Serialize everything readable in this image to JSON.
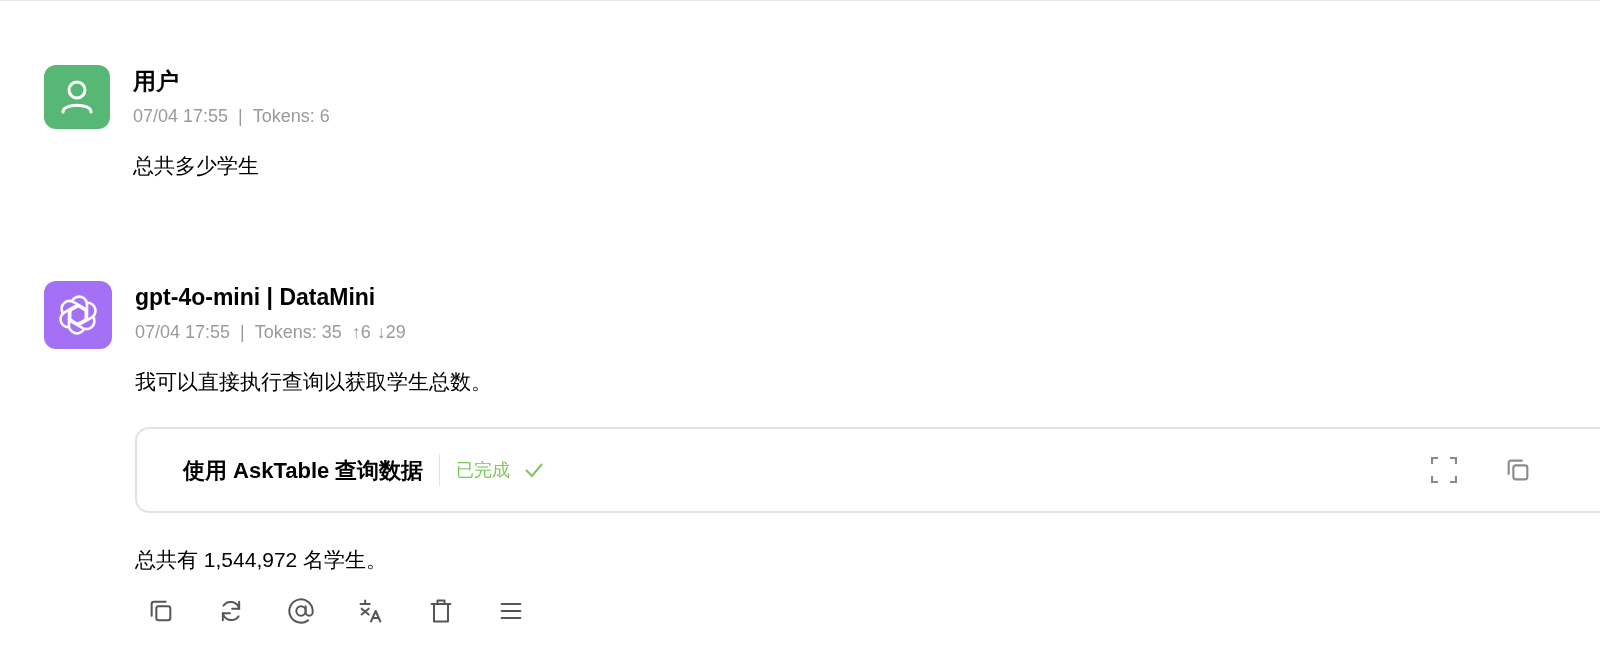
{
  "messages": [
    {
      "kind": "user",
      "name": "用户",
      "time": "07/04 17:55",
      "separator": "|",
      "tokens": "Tokens: 6",
      "content": [
        {
          "kind": "text",
          "text": "总共多少学生"
        }
      ]
    },
    {
      "kind": "assistant",
      "name": "gpt-4o-mini | DataMini",
      "time": "07/04 17:55",
      "separator": "|",
      "tokens": "Tokens: 35",
      "tokens_in": "↑6",
      "tokens_out": "↓29",
      "content": [
        {
          "kind": "text",
          "text": "我可以直接执行查询以获取学生总数。"
        },
        {
          "kind": "tool",
          "title": "使用 AskTable 查询数据",
          "status": "已完成",
          "done": true
        },
        {
          "kind": "text",
          "text": "总共有 1,544,972 名学生。"
        }
      ],
      "actions": [
        {
          "kind": "copy"
        },
        {
          "kind": "regenerate"
        },
        {
          "kind": "mention"
        },
        {
          "kind": "translate"
        },
        {
          "kind": "delete"
        },
        {
          "kind": "more"
        }
      ]
    }
  ]
}
